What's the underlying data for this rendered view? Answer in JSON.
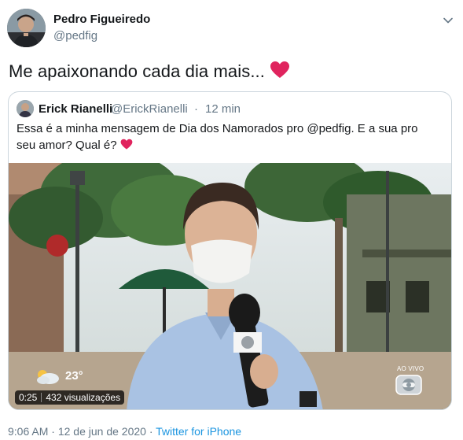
{
  "author": {
    "name": "Pedro Figueiredo",
    "handle": "@pedfig"
  },
  "tweet_text": "Me apaixonando cada dia mais...",
  "quoted": {
    "name": "Erick Rianelli",
    "handle": "@ErickRianelli",
    "separator": "·",
    "time": "12 min",
    "text": "Essa é a minha mensagem de Dia dos Namorados pro @pedfig. E a sua pro seu amor? Qual é?",
    "video": {
      "temperature": "23°",
      "duration": "0:25",
      "views": "432 visualizações",
      "live_label": "AO VIVO"
    }
  },
  "meta": {
    "time": "9:06 AM",
    "date": "12 de jun de 2020",
    "separator1": "·",
    "source": "Twitter for iPhone"
  },
  "colors": {
    "heart": "#e0245e",
    "link": "#1b95e0",
    "secondary": "#657786"
  },
  "icons": [
    "chevron-down-icon",
    "heart-icon",
    "weather-icon",
    "globo-logo-icon"
  ]
}
